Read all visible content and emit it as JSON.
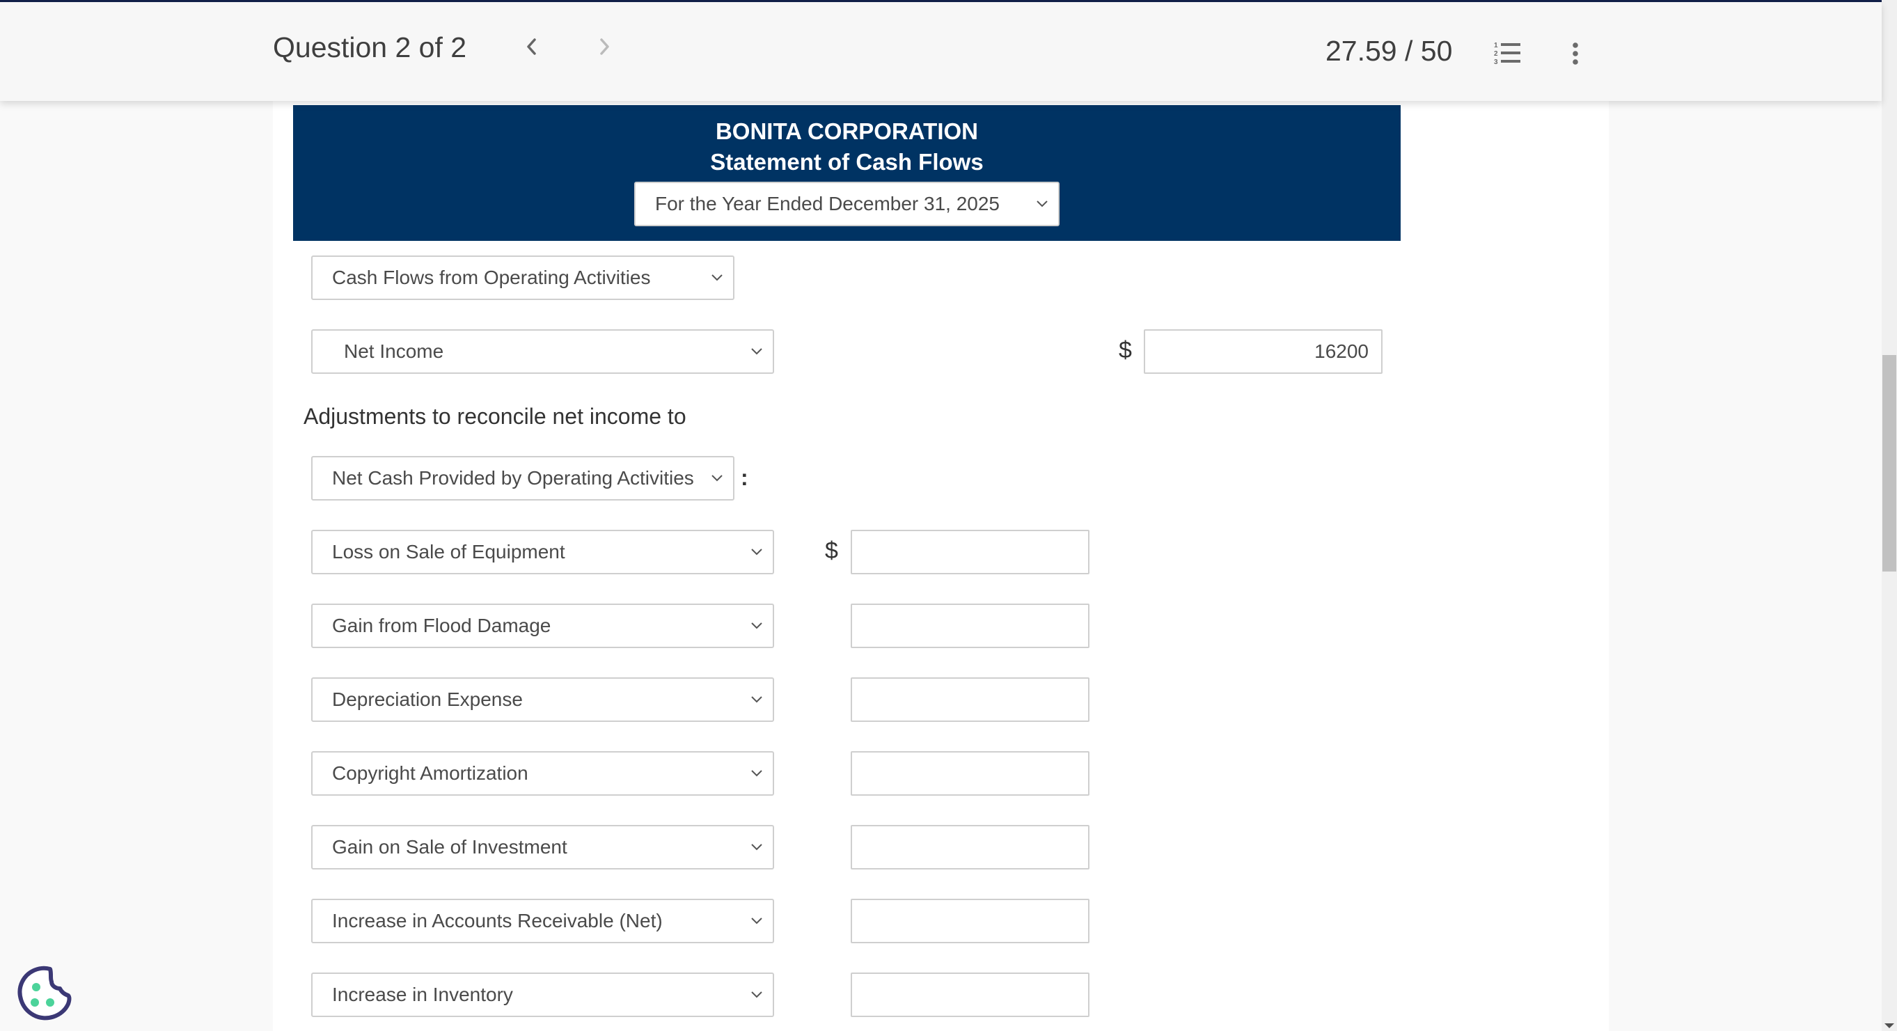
{
  "header": {
    "question_label": "Question 2 of 2",
    "score": "27.59 / 50",
    "icons": {
      "prev": "chevron-left-icon",
      "next": "chevron-right-icon",
      "question_list": "numbered-list-icon",
      "more": "kebab-menu-icon"
    },
    "next_disabled": true
  },
  "statement": {
    "company": "BONITA CORPORATION",
    "title": "Statement of Cash Flows",
    "period_selected": "For the Year Ended December 31, 2025",
    "banner_color": "#003363"
  },
  "sections": {
    "operating_heading_selected": "Cash Flows from Operating Activities",
    "net_income": {
      "label_selected": "Net Income",
      "currency": "$",
      "value": "16200"
    },
    "adjustments_label": "Adjustments to reconcile net income to",
    "adjustments_target_selected": "Net Cash Provided by Operating Activities",
    "adjustments_suffix": ":",
    "adjustment_rows": [
      {
        "label_selected": "Loss on Sale of Equipment",
        "currency": "$",
        "value": ""
      },
      {
        "label_selected": "Gain from Flood Damage",
        "currency": "",
        "value": ""
      },
      {
        "label_selected": "Depreciation Expense",
        "currency": "",
        "value": ""
      },
      {
        "label_selected": "Copyright Amortization",
        "currency": "",
        "value": ""
      },
      {
        "label_selected": "Gain on Sale of Investment",
        "currency": "",
        "value": ""
      },
      {
        "label_selected": "Increase in Accounts Receivable (Net)",
        "currency": "",
        "value": ""
      },
      {
        "label_selected": "Increase in Inventory",
        "currency": "",
        "value": ""
      }
    ]
  },
  "widgets": {
    "cookie_settings": "cookie-icon"
  }
}
